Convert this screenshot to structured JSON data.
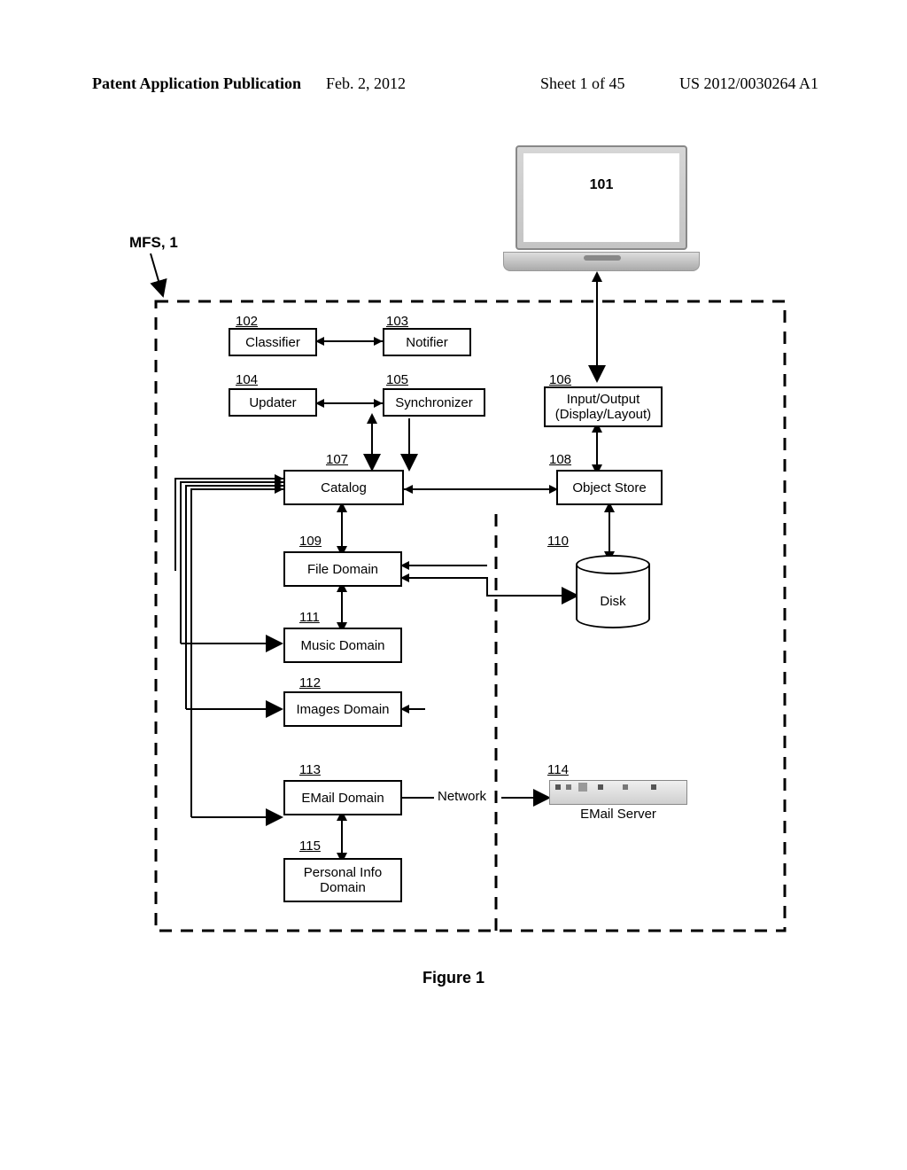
{
  "header": {
    "left": "Patent Application Publication",
    "date": "Feb. 2, 2012",
    "sheet": "Sheet 1 of 45",
    "pubnum": "US 2012/0030264 A1"
  },
  "mfs": "MFS, 1",
  "labels": {
    "n101": "101",
    "n102": "102",
    "n103": "103",
    "n104": "104",
    "n105": "105",
    "n106": "106",
    "n107": "107",
    "n108": "108",
    "n109": "109",
    "n110": "110",
    "n111": "111",
    "n112": "112",
    "n113": "113",
    "n114": "114",
    "n115": "115"
  },
  "boxes": {
    "classifier": "Classifier",
    "notifier": "Notifier",
    "updater": "Updater",
    "synchronizer": "Synchronizer",
    "io": "Input/Output\n(Display/Layout)",
    "catalog": "Catalog",
    "objstore": "Object Store",
    "filedomain": "File Domain",
    "musicdomain": "Music Domain",
    "imagesdomain": "Images Domain",
    "emaildomain": "EMail Domain",
    "personal": "Personal Info\nDomain",
    "disk": "Disk",
    "network": "Network",
    "emailserver": "EMail Server"
  },
  "figure": "Figure 1"
}
